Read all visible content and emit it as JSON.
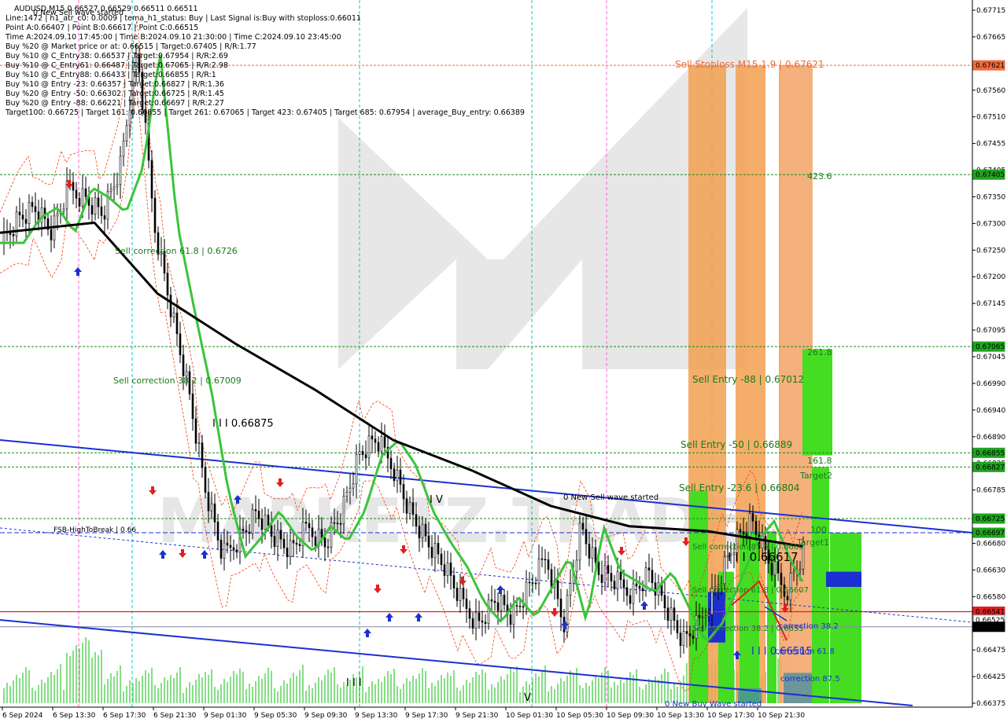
{
  "header": {
    "symbol_line": "AUDUSD,M15  0.66527 0.66529 0.66511 0.66511",
    "top_overlay": "0 New Sell wave started",
    "lines": [
      "Line:1472  |  h1_atr_c0: 0.0009  |  tema_h1_status: Buy  |  Last Signal is:Buy with stoploss:0.66011",
      "Point A:0.66407  |  Point B:0.66617  |  Point C:0.66515",
      "Time A:2024.09.10 17:45:00  |  Time B:2024.09.10 21:30:00  |  Time C:2024.09.10 23:45:00",
      "Buy %20 @ Market price or at: 0.66515  |  Target:0.67405  |  R/R:1.77",
      "Buy %10 @ C_Entry38: 0.66537  |  Target:0.67954  |  R/R:2.69",
      "Buy %10 @ C_Entry61: 0.66487  |  Target:0.67065  |  R/R:2.98",
      "Buy %10 @ C_Entry88: 0.66433  |  Target:0.66855  |  R/R:1",
      "Buy %10 @ Entry -23: 0.66357  |  Target:0.66827  |  R/R:1.36",
      "Buy %20 @ Entry -50: 0.66302  |  Target:0.66725  |  R/R:1.45",
      "Buy %20 @ Entry -88: 0.66221  |  Target:0.66697  |  R/R:2.27",
      "Target100: 0.66725  |  Target 161: 0.66855  |  Target 261: 0.67065  |  Target 423: 0.67405  |  Target 685: 0.67954  |  average_Buy_entry: 0.66389"
    ]
  },
  "annotations": {
    "sell_correction_618": "Sell correction 61.8 | 0.6726",
    "sell_correction_382": "Sell correction 38.2 | 0.67009",
    "wave_high": "I I I  0.66875",
    "wave_iv": "I V",
    "fsb": "FSB-HighToBreak | 0.66",
    "new_sell_wave": "0 New Sell wave started",
    "sell_stoploss": "Sell Stoploss M15 1.9 | 0.67621",
    "sell_entry_88": "Sell Entry -88 | 0.67012",
    "sell_entry_50": "Sell Entry -50 | 0.66889",
    "sell_entry_236": "Sell Entry -23.6 | 0.66804",
    "sell_correction_875": "Sell correction 87.5 | 0.6660",
    "sell_correction_61_b": "Sell correction 61.8 | 0.66607",
    "sell_correction_382_b": "Sell correction 38.2 | 0.6655",
    "point_b": "I I I  0.66617",
    "point_c": "I I I  0.66515",
    "correction_382": "correction 38.2",
    "correction_618": "correction 61.8",
    "correction_875": "correction 87.5",
    "new_buy_wave": "0 New Buy Wave started",
    "target1": "Target1",
    "target2": "Target2",
    "lvl_4236": "423.6",
    "lvl_2618": "261.8",
    "lvl_1618": "161.8",
    "lvl_100": "100",
    "wave_iii_bottom": "I I I",
    "wave_v_bottom": "V"
  },
  "price_axis": [
    "0.67715",
    "0.67665",
    "0.67610",
    "0.67560",
    "0.67510",
    "0.67455",
    "0.67405",
    "0.67350",
    "0.67300",
    "0.67250",
    "0.67200",
    "0.67145",
    "0.67095",
    "0.67045",
    "0.66990",
    "0.66940",
    "0.66890",
    "0.66835",
    "0.66785",
    "0.66735",
    "0.66680",
    "0.66630",
    "0.66580",
    "0.66525",
    "0.66475",
    "0.66425",
    "0.66375"
  ],
  "time_axis": [
    "6 Sep 2024",
    "6 Sep 13:30",
    "6 Sep 17:30",
    "6 Sep 21:30",
    "9 Sep 01:30",
    "9 Sep 05:30",
    "9 Sep 09:30",
    "9 Sep 13:30",
    "9 Sep 17:30",
    "9 Sep 21:30",
    "10 Sep 01:30",
    "10 Sep 05:30",
    "10 Sep 09:30",
    "10 Sep 13:30",
    "10 Sep 17:30",
    "10 Sep 21:30"
  ],
  "price_tags": [
    {
      "label": "0.67621",
      "bg": "#f26b3a"
    },
    {
      "label": "0.67405",
      "bg": "#1fa51f"
    },
    {
      "label": "0.67065",
      "bg": "#1fa51f"
    },
    {
      "label": "0.66855",
      "bg": "#1fa51f"
    },
    {
      "label": "0.66827",
      "bg": "#1fa51f"
    },
    {
      "label": "0.66725",
      "bg": "#1fa51f"
    },
    {
      "label": "0.66697",
      "bg": "#1fa51f"
    },
    {
      "label": "0.66541",
      "bg": "#e02020"
    },
    {
      "label": "0.66525",
      "bg": "#ffffff"
    },
    {
      "label": "0.66511",
      "bg": "#000000"
    }
  ],
  "watermark": "MARKETZ.TRADE",
  "chart_data": {
    "type": "candlestick",
    "symbol": "AUDUSD",
    "timeframe": "M15",
    "ylim": [
      0.6636,
      0.6773
    ],
    "levels": {
      "sell_stoploss": 0.67621,
      "target_423": 0.67405,
      "target_261": 0.67065,
      "target_161": 0.66855,
      "target2": 0.66827,
      "target100": 0.66725,
      "target1": 0.66697,
      "last_red": 0.66541,
      "current": 0.66511
    },
    "close_path": [
      0.6727,
      0.6732,
      0.6734,
      0.6729,
      0.6738,
      0.6736,
      0.6733,
      0.6742,
      0.6765,
      0.6731,
      0.6714,
      0.6698,
      0.6678,
      0.6665,
      0.6669,
      0.6674,
      0.6669,
      0.6666,
      0.6671,
      0.6668,
      0.6674,
      0.6685,
      0.6688,
      0.6683,
      0.6674,
      0.6668,
      0.6663,
      0.6656,
      0.6652,
      0.6657,
      0.6653,
      0.6659,
      0.6665,
      0.6652,
      0.6671,
      0.6662,
      0.666,
      0.6658,
      0.6662,
      0.6655,
      0.6648,
      0.6652,
      0.666,
      0.6668,
      0.6672,
      0.6664,
      0.6658,
      0.6666,
      0.6673,
      0.6665,
      0.6663,
      0.6655,
      0.665,
      0.6663,
      0.6657,
      0.6665,
      0.6653,
      0.6651
    ]
  }
}
